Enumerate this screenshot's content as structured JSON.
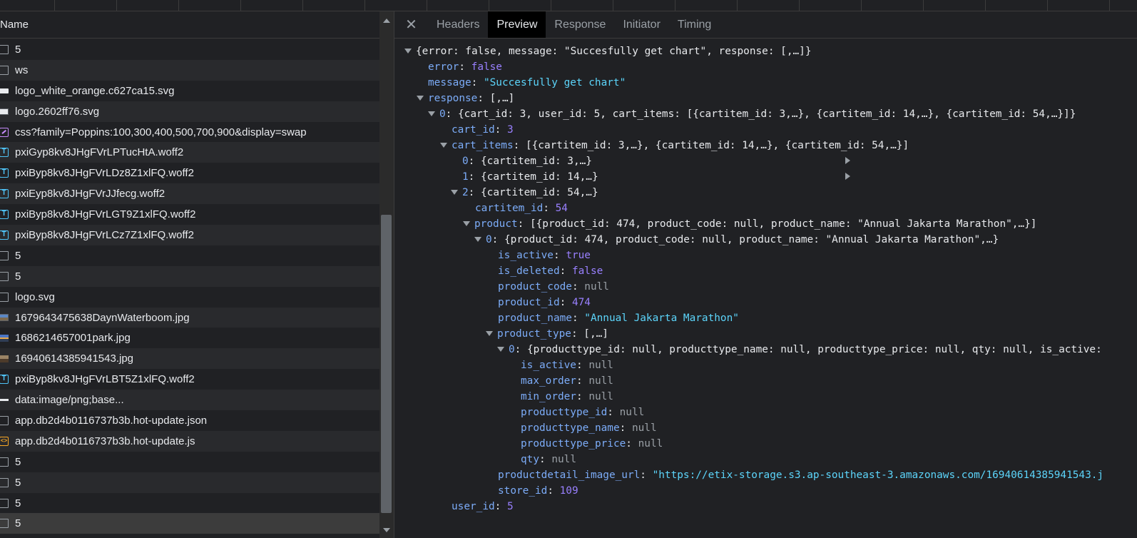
{
  "network": {
    "column_header": "Name",
    "requests": [
      {
        "name": "5",
        "icon": "doc-icon"
      },
      {
        "name": "ws",
        "icon": "doc-icon"
      },
      {
        "name": "logo_white_orange.c627ca15.svg",
        "icon": "svg-image-icon"
      },
      {
        "name": "logo.2602ff76.svg",
        "icon": "svg-image-icon"
      },
      {
        "name": "css?family=Poppins:100,300,400,500,700,900&display=swap",
        "icon": "stylesheet-icon"
      },
      {
        "name": "pxiGyp8kv8JHgFVrLPTucHtA.woff2",
        "icon": "font-icon"
      },
      {
        "name": "pxiByp8kv8JHgFVrLDz8Z1xlFQ.woff2",
        "icon": "font-icon"
      },
      {
        "name": "pxiEyp8kv8JHgFVrJJfecg.woff2",
        "icon": "font-icon"
      },
      {
        "name": "pxiByp8kv8JHgFVrLGT9Z1xlFQ.woff2",
        "icon": "font-icon"
      },
      {
        "name": "pxiByp8kv8JHgFVrLCz7Z1xlFQ.woff2",
        "icon": "font-icon"
      },
      {
        "name": "5",
        "icon": "doc-icon"
      },
      {
        "name": "5",
        "icon": "doc-icon"
      },
      {
        "name": "logo.svg",
        "icon": "doc-icon"
      },
      {
        "name": "1679643475638DaynWaterboom.jpg",
        "icon": "image-icon"
      },
      {
        "name": "1686214657001park.jpg",
        "icon": "image-icon"
      },
      {
        "name": "16940614385941543.jpg",
        "icon": "image-icon"
      },
      {
        "name": "pxiByp8kv8JHgFVrLBT5Z1xlFQ.woff2",
        "icon": "font-icon"
      },
      {
        "name": "data:image/png;base...",
        "icon": "data-image-icon"
      },
      {
        "name": "app.db2d4b0116737b3b.hot-update.json",
        "icon": "doc-icon"
      },
      {
        "name": "app.db2d4b0116737b3b.hot-update.js",
        "icon": "script-icon"
      },
      {
        "name": "5",
        "icon": "doc-icon"
      },
      {
        "name": "5",
        "icon": "doc-icon"
      },
      {
        "name": "5",
        "icon": "doc-icon"
      },
      {
        "name": "5",
        "icon": "doc-icon"
      }
    ]
  },
  "details": {
    "close_label": "✕",
    "tabs": [
      "Headers",
      "Preview",
      "Response",
      "Initiator",
      "Timing"
    ],
    "active_tab": "Preview"
  },
  "preview": {
    "root_summary": "{error: false, message: \"Succesfully get chart\", response: [,…]}",
    "error_key": "error",
    "error_val": "false",
    "message_key": "message",
    "message_val": "\"Succesfully get chart\"",
    "response_key": "response",
    "response_summary": "[,…]",
    "item0_key": "0",
    "item0_summary": "{cart_id: 3, user_id: 5, cart_items: [{cartitem_id: 3,…}, {cartitem_id: 14,…}, {cartitem_id: 54,…}]}",
    "cart_id_key": "cart_id",
    "cart_id_val": "3",
    "cart_items_key": "cart_items",
    "cart_items_summary": "[{cartitem_id: 3,…}, {cartitem_id: 14,…}, {cartitem_id: 54,…}]",
    "ci0_key": "0",
    "ci0_summary": "{cartitem_id: 3,…}",
    "ci1_key": "1",
    "ci1_summary": "{cartitem_id: 14,…}",
    "ci2_key": "2",
    "ci2_summary": "{cartitem_id: 54,…}",
    "cartitem_id_key": "cartitem_id",
    "cartitem_id_val": "54",
    "product_key": "product",
    "product_summary": "[{product_id: 474, product_code: null, product_name: \"Annual Jakarta Marathon\",…}]",
    "p0_key": "0",
    "p0_summary": "{product_id: 474, product_code: null, product_name: \"Annual Jakarta Marathon\",…}",
    "is_active_key": "is_active",
    "is_active_val": "true",
    "is_deleted_key": "is_deleted",
    "is_deleted_val": "false",
    "product_code_key": "product_code",
    "product_code_val": "null",
    "product_id_key": "product_id",
    "product_id_val": "474",
    "product_name_key": "product_name",
    "product_name_val": "\"Annual Jakarta Marathon\"",
    "product_type_key": "product_type",
    "product_type_summary": "[,…]",
    "pt0_key": "0",
    "pt0_summary": "{producttype_id: null, producttype_name: null, producttype_price: null, qty: null, is_active:",
    "pt_is_active_key": "is_active",
    "pt_is_active_val": "null",
    "max_order_key": "max_order",
    "max_order_val": "null",
    "min_order_key": "min_order",
    "min_order_val": "null",
    "producttype_id_key": "producttype_id",
    "producttype_id_val": "null",
    "producttype_name_key": "producttype_name",
    "producttype_name_val": "null",
    "producttype_price_key": "producttype_price",
    "producttype_price_val": "null",
    "qty_key": "qty",
    "qty_val": "null",
    "productdetail_image_url_key": "productdetail_image_url",
    "productdetail_image_url_val": "\"https://etix-storage.s3.ap-southeast-3.amazonaws.com/16940614385941543.j",
    "store_id_key": "store_id",
    "store_id_val": "109",
    "user_id_key": "user_id",
    "user_id_val": "5"
  },
  "colors": {
    "key": "#7cacf8",
    "string": "#5cd5fb",
    "number": "#9980ff",
    "null": "#9aa0a6",
    "active_tab_bg": "#000000"
  }
}
